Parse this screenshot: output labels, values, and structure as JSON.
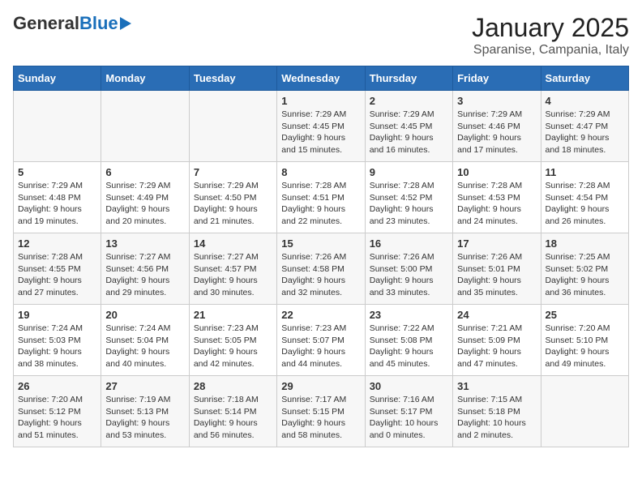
{
  "logo": {
    "general": "General",
    "blue": "Blue"
  },
  "title": {
    "month": "January 2025",
    "location": "Sparanise, Campania, Italy"
  },
  "weekdays": [
    "Sunday",
    "Monday",
    "Tuesday",
    "Wednesday",
    "Thursday",
    "Friday",
    "Saturday"
  ],
  "weeks": [
    [
      {
        "day": "",
        "info": ""
      },
      {
        "day": "",
        "info": ""
      },
      {
        "day": "",
        "info": ""
      },
      {
        "day": "1",
        "info": "Sunrise: 7:29 AM\nSunset: 4:45 PM\nDaylight: 9 hours and 15 minutes."
      },
      {
        "day": "2",
        "info": "Sunrise: 7:29 AM\nSunset: 4:45 PM\nDaylight: 9 hours and 16 minutes."
      },
      {
        "day": "3",
        "info": "Sunrise: 7:29 AM\nSunset: 4:46 PM\nDaylight: 9 hours and 17 minutes."
      },
      {
        "day": "4",
        "info": "Sunrise: 7:29 AM\nSunset: 4:47 PM\nDaylight: 9 hours and 18 minutes."
      }
    ],
    [
      {
        "day": "5",
        "info": "Sunrise: 7:29 AM\nSunset: 4:48 PM\nDaylight: 9 hours and 19 minutes."
      },
      {
        "day": "6",
        "info": "Sunrise: 7:29 AM\nSunset: 4:49 PM\nDaylight: 9 hours and 20 minutes."
      },
      {
        "day": "7",
        "info": "Sunrise: 7:29 AM\nSunset: 4:50 PM\nDaylight: 9 hours and 21 minutes."
      },
      {
        "day": "8",
        "info": "Sunrise: 7:28 AM\nSunset: 4:51 PM\nDaylight: 9 hours and 22 minutes."
      },
      {
        "day": "9",
        "info": "Sunrise: 7:28 AM\nSunset: 4:52 PM\nDaylight: 9 hours and 23 minutes."
      },
      {
        "day": "10",
        "info": "Sunrise: 7:28 AM\nSunset: 4:53 PM\nDaylight: 9 hours and 24 minutes."
      },
      {
        "day": "11",
        "info": "Sunrise: 7:28 AM\nSunset: 4:54 PM\nDaylight: 9 hours and 26 minutes."
      }
    ],
    [
      {
        "day": "12",
        "info": "Sunrise: 7:28 AM\nSunset: 4:55 PM\nDaylight: 9 hours and 27 minutes."
      },
      {
        "day": "13",
        "info": "Sunrise: 7:27 AM\nSunset: 4:56 PM\nDaylight: 9 hours and 29 minutes."
      },
      {
        "day": "14",
        "info": "Sunrise: 7:27 AM\nSunset: 4:57 PM\nDaylight: 9 hours and 30 minutes."
      },
      {
        "day": "15",
        "info": "Sunrise: 7:26 AM\nSunset: 4:58 PM\nDaylight: 9 hours and 32 minutes."
      },
      {
        "day": "16",
        "info": "Sunrise: 7:26 AM\nSunset: 5:00 PM\nDaylight: 9 hours and 33 minutes."
      },
      {
        "day": "17",
        "info": "Sunrise: 7:26 AM\nSunset: 5:01 PM\nDaylight: 9 hours and 35 minutes."
      },
      {
        "day": "18",
        "info": "Sunrise: 7:25 AM\nSunset: 5:02 PM\nDaylight: 9 hours and 36 minutes."
      }
    ],
    [
      {
        "day": "19",
        "info": "Sunrise: 7:24 AM\nSunset: 5:03 PM\nDaylight: 9 hours and 38 minutes."
      },
      {
        "day": "20",
        "info": "Sunrise: 7:24 AM\nSunset: 5:04 PM\nDaylight: 9 hours and 40 minutes."
      },
      {
        "day": "21",
        "info": "Sunrise: 7:23 AM\nSunset: 5:05 PM\nDaylight: 9 hours and 42 minutes."
      },
      {
        "day": "22",
        "info": "Sunrise: 7:23 AM\nSunset: 5:07 PM\nDaylight: 9 hours and 44 minutes."
      },
      {
        "day": "23",
        "info": "Sunrise: 7:22 AM\nSunset: 5:08 PM\nDaylight: 9 hours and 45 minutes."
      },
      {
        "day": "24",
        "info": "Sunrise: 7:21 AM\nSunset: 5:09 PM\nDaylight: 9 hours and 47 minutes."
      },
      {
        "day": "25",
        "info": "Sunrise: 7:20 AM\nSunset: 5:10 PM\nDaylight: 9 hours and 49 minutes."
      }
    ],
    [
      {
        "day": "26",
        "info": "Sunrise: 7:20 AM\nSunset: 5:12 PM\nDaylight: 9 hours and 51 minutes."
      },
      {
        "day": "27",
        "info": "Sunrise: 7:19 AM\nSunset: 5:13 PM\nDaylight: 9 hours and 53 minutes."
      },
      {
        "day": "28",
        "info": "Sunrise: 7:18 AM\nSunset: 5:14 PM\nDaylight: 9 hours and 56 minutes."
      },
      {
        "day": "29",
        "info": "Sunrise: 7:17 AM\nSunset: 5:15 PM\nDaylight: 9 hours and 58 minutes."
      },
      {
        "day": "30",
        "info": "Sunrise: 7:16 AM\nSunset: 5:17 PM\nDaylight: 10 hours and 0 minutes."
      },
      {
        "day": "31",
        "info": "Sunrise: 7:15 AM\nSunset: 5:18 PM\nDaylight: 10 hours and 2 minutes."
      },
      {
        "day": "",
        "info": ""
      }
    ]
  ]
}
